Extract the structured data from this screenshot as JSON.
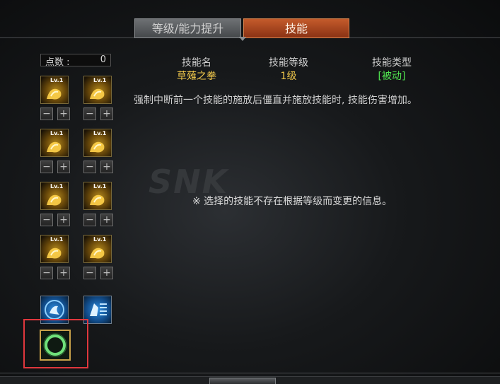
{
  "tabs": [
    {
      "label": "等级/能力提升"
    },
    {
      "label": "技能"
    }
  ],
  "points": {
    "label": "点数 :",
    "value": "0"
  },
  "skills": {
    "level_badge": "Lv.1",
    "minus": "−",
    "plus": "+"
  },
  "detail": {
    "headers": {
      "name": "技能名",
      "level": "技能等级",
      "type": "技能类型"
    },
    "values": {
      "name": "草薙之拳",
      "level": "1级",
      "type": "[被动]"
    },
    "description": "强制中断前一个技能的施放后僵直并施放技能时, 技能伤害增加。",
    "notice": "※ 选择的技能不存在根据等级而变更的信息。"
  },
  "watermark": "SNK",
  "colors": {
    "name": "#f2c94c",
    "level": "#f2c94c",
    "type": "#4fe34f",
    "active_tab": "#b24a1f",
    "highlight": "#e0373d"
  },
  "icons": [
    "fist-skill-icon",
    "fist-skill-icon",
    "fist-skill-icon",
    "fist-skill-icon",
    "fist-skill-icon",
    "fist-skill-icon",
    "fist-skill-icon",
    "fist-skill-icon",
    "blue-skill-icon",
    "blue-skill-icon",
    "ring-skill-icon"
  ]
}
